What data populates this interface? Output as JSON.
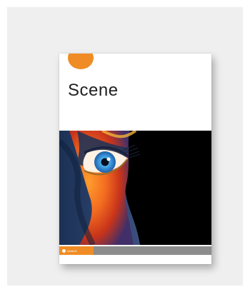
{
  "cover": {
    "title": "Scene",
    "badge_text": "",
    "publisher": "intellect",
    "issn": "",
    "colors": {
      "background": "#efefef",
      "accent": "#f08c25",
      "footer": "#8c8c8c"
    },
    "artwork": "painted-face-eye-closeup"
  }
}
